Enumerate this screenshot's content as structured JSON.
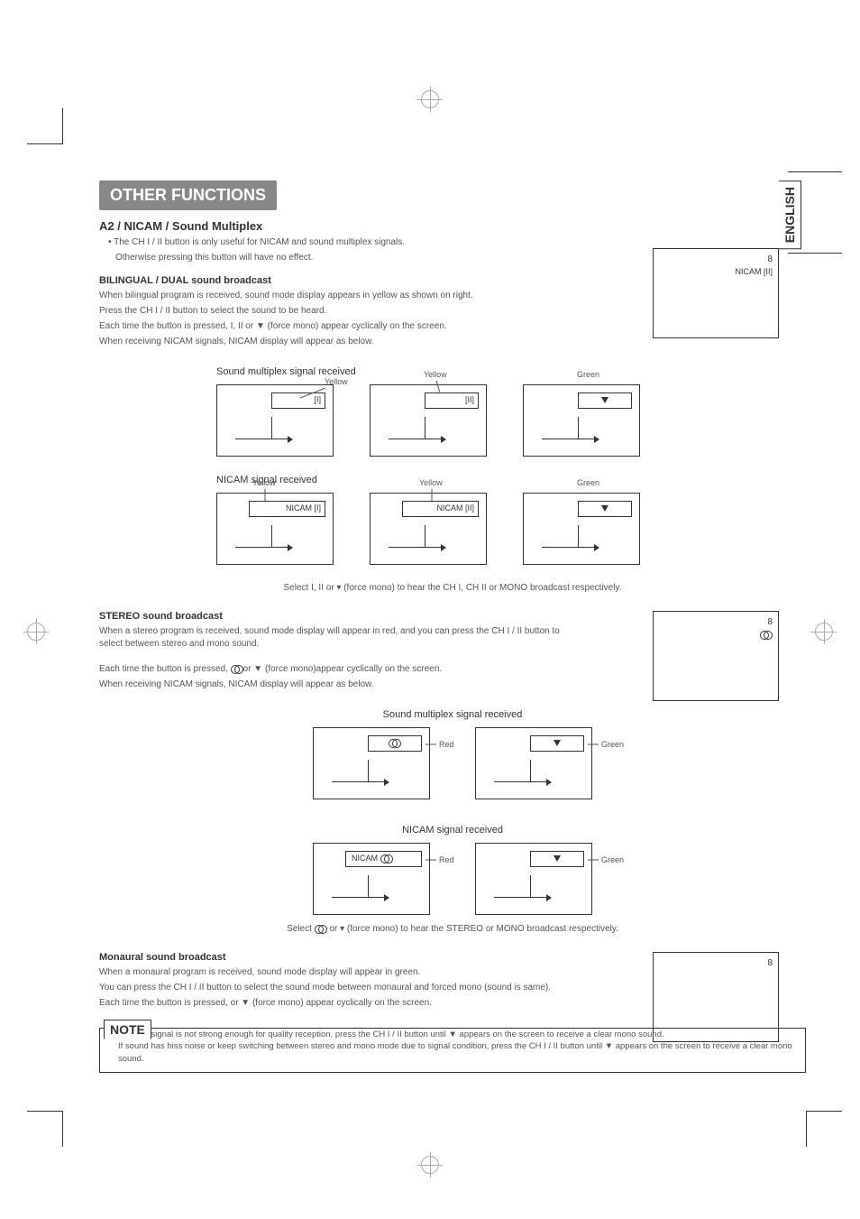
{
  "language_tab": "ENGLISH",
  "section_title": "OTHER FUNCTIONS",
  "a2_section": {
    "title": "A2 / NICAM / Sound Multiplex",
    "bullet": "• The CH I / II button is only useful for NICAM and sound multiplex signals.",
    "bullet2": "Otherwise pressing this button will have no effect."
  },
  "bilingual": {
    "heading": "BILINGUAL / DUAL sound broadcast",
    "p1": "When bilingual program is received, sound mode display appears in yellow as shown on right.",
    "p2": "Press the CH I / II button to select the sound to be heard.",
    "p3": "Each time the button is pressed, I, II or ▼ (force mono) appear cyclically on the screen.",
    "p4": "When receiving NICAM signals, NICAM display will appear as below.",
    "osd_num": "8",
    "osd_label": "NICAM [II]"
  },
  "multiplex_row": {
    "title": "Sound multiplex signal received",
    "box1_label": "[I]",
    "box1_color": "Yellow",
    "box2_label": "[II]",
    "box2_color": "Yellow",
    "box3_color": "Green"
  },
  "nicam_row": {
    "title": "NICAM signal received",
    "box1_label": "NICAM [I]",
    "box1_color": "Yellow",
    "box2_label": "NICAM [II]",
    "box2_color": "Yellow",
    "box3_color": "Green"
  },
  "select_text_1": "Select I, II or  ▾ (force mono) to hear the CH I, CH II or MONO broadcast respectively.",
  "stereo": {
    "heading": "STEREO sound broadcast",
    "p1": "When a stereo program is received, sound mode display will appear in red, and you can press the CH I / II button to select between stereo and mono sound.",
    "p2": "Each time the button is pressed,  ⟲or ▼ (force mono)appear cyclically on the screen.",
    "p3": "When receiving NICAM signals, NICAM display will appear as below.",
    "osd_num": "8"
  },
  "stereo_multiplex": {
    "title": "Sound multiplex signal received",
    "color1": "Red",
    "color2": "Green"
  },
  "stereo_nicam": {
    "title": "NICAM signal received",
    "box1_label": "NICAM",
    "color1": "Red",
    "color2": "Green"
  },
  "select_text_2": "Select ⟲ or ▾ (force mono) to hear the STEREO or MONO broadcast respectively.",
  "monaural": {
    "heading": "Monaural sound broadcast",
    "p1": "When a monaural program is received, sound mode display will appear in green.",
    "p2": "You can press the CH I / II button to select the sound mode between monaural and forced mono (sound is same).",
    "p3": "Each time the button is pressed,     or ▼ (force mono) appear cyclically on the screen.",
    "osd_num": "8"
  },
  "note": {
    "heading": "NOTE",
    "l1": "If sound signal is not strong enough for quality reception, press the CH I / II button until ▼ appears on the screen to receive a clear mono sound.",
    "l2": "If sound has hiss noise or keep switching between stereo and mono mode due to signal condition, press the CH I / II button until ▼ appears on the screen to receive a clear mono sound."
  }
}
